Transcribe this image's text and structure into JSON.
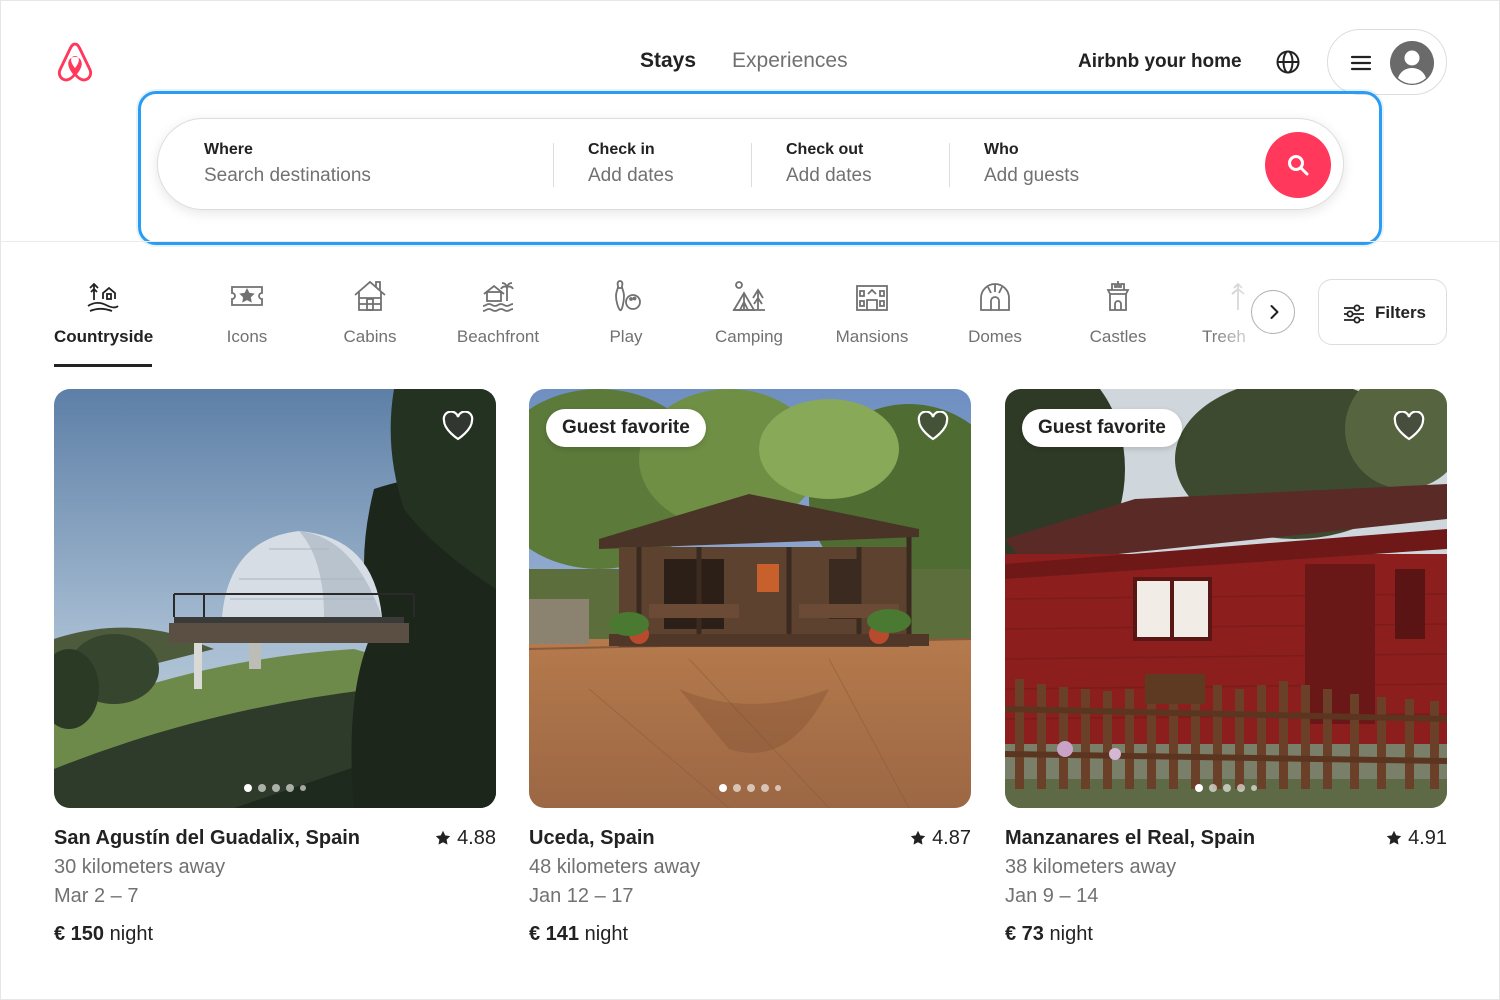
{
  "header": {
    "tabs": [
      {
        "label": "Stays",
        "active": true
      },
      {
        "label": "Experiences",
        "active": false
      }
    ],
    "host_link": "Airbnb your home",
    "brand_color": "#FF385C"
  },
  "search": {
    "where": {
      "label": "Where",
      "placeholder": "Search destinations"
    },
    "check_in": {
      "label": "Check in",
      "placeholder": "Add dates"
    },
    "check_out": {
      "label": "Check out",
      "placeholder": "Add dates"
    },
    "who": {
      "label": "Who",
      "placeholder": "Add guests"
    },
    "highlight_color": "#2B9CF2"
  },
  "categories": [
    {
      "label": "Countryside",
      "icon": "countryside-icon",
      "active": true
    },
    {
      "label": "Icons",
      "icon": "icons-ticket-icon",
      "active": false
    },
    {
      "label": "Cabins",
      "icon": "cabin-icon",
      "active": false
    },
    {
      "label": "Beachfront",
      "icon": "beachfront-icon",
      "active": false
    },
    {
      "label": "Play",
      "icon": "bowling-icon",
      "active": false
    },
    {
      "label": "Camping",
      "icon": "camping-icon",
      "active": false
    },
    {
      "label": "Mansions",
      "icon": "mansion-icon",
      "active": false
    },
    {
      "label": "Domes",
      "icon": "dome-icon",
      "active": false
    },
    {
      "label": "Castles",
      "icon": "castle-icon",
      "active": false
    },
    {
      "label": "Treeh",
      "icon": "treehouse-icon",
      "active": false
    }
  ],
  "filters": {
    "label": "Filters"
  },
  "listings": [
    {
      "title": "San Agustín del Guadalix, Spain",
      "rating": "4.88",
      "distance": "30 kilometers away",
      "dates": "Mar 2 – 7",
      "price": "€ 150",
      "price_unit": "night",
      "badge": "",
      "photo": "geodesic-dome-on-hillside"
    },
    {
      "title": "Uceda, Spain",
      "rating": "4.87",
      "distance": "48 kilometers away",
      "dates": "Jan 12 – 17",
      "price": "€ 141",
      "price_unit": "night",
      "badge": "Guest favorite",
      "photo": "wooden-cabin-with-porch"
    },
    {
      "title": "Manzanares el Real, Spain",
      "rating": "4.91",
      "distance": "38 kilometers away",
      "dates": "Jan 9 – 14",
      "price": "€ 73",
      "price_unit": "night",
      "badge": "Guest favorite",
      "photo": "red-wooden-cabin-with-fence"
    }
  ]
}
